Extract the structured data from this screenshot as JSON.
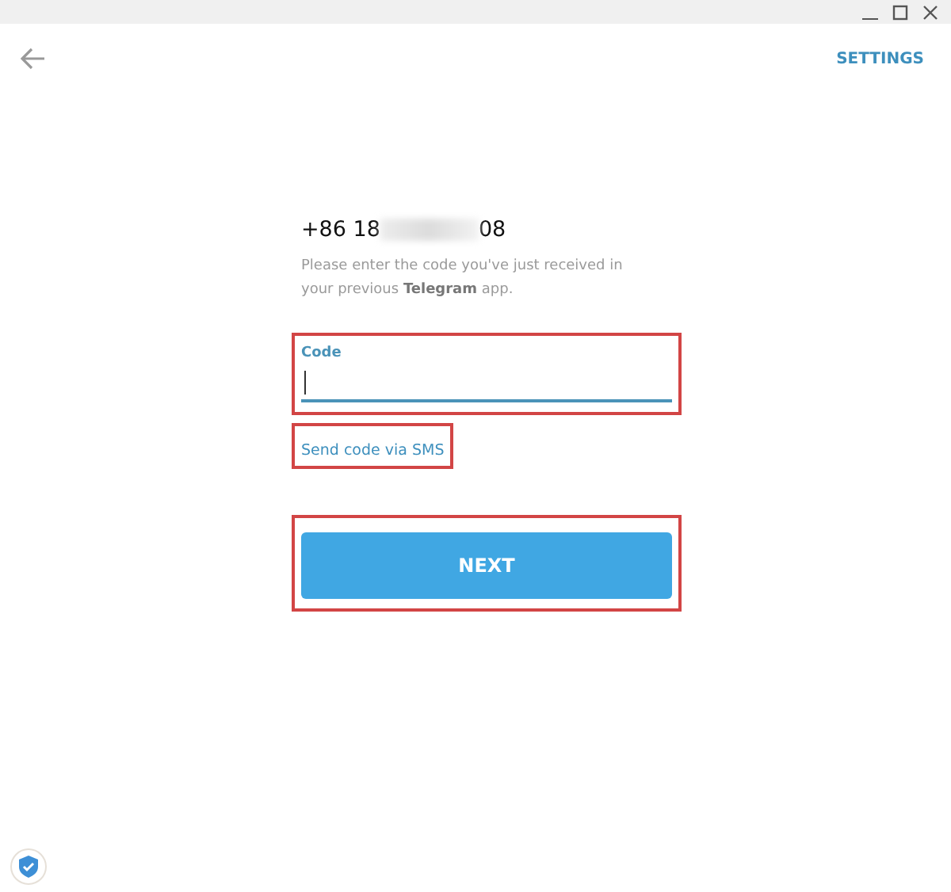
{
  "header": {
    "action": "SETTINGS"
  },
  "phone": {
    "prefix": "+86 18",
    "suffix": "08"
  },
  "hint": "Please enter the code you've just received in your previous **Telegram** app.",
  "code_field": {
    "label": "Code",
    "focused": true
  },
  "send_sms_link": "Send code via SMS",
  "next_button": "NEXT"
}
